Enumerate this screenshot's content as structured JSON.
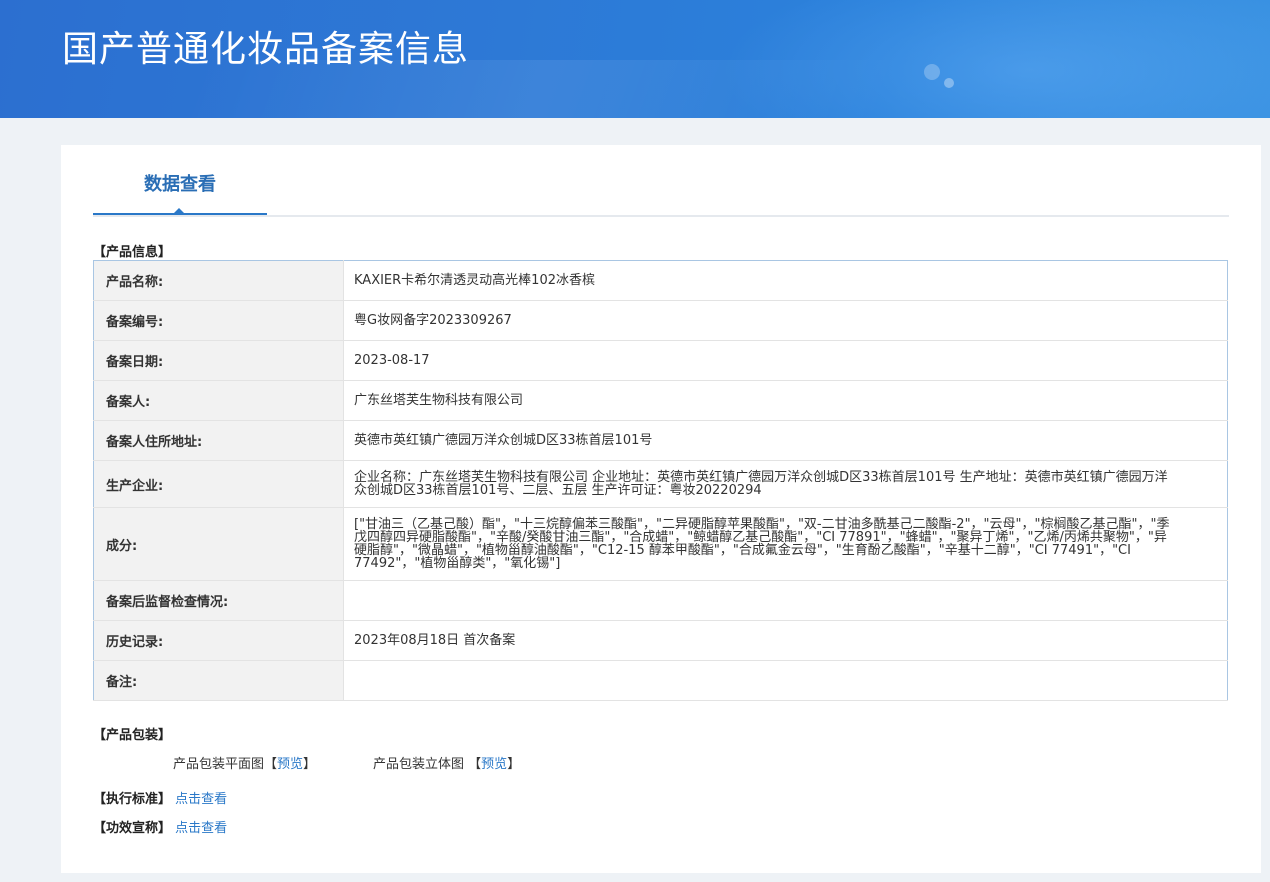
{
  "header": {
    "title": "国产普通化妆品备案信息"
  },
  "tabs": [
    {
      "label": "数据查看"
    }
  ],
  "product_section": {
    "title": "【产品信息】",
    "rows": [
      {
        "label": "产品名称:",
        "value": "KAXIER卡希尔清透灵动高光棒102冰香槟"
      },
      {
        "label": "备案编号:",
        "value": "粤G妆网备字2023309267"
      },
      {
        "label": "备案日期:",
        "value": "2023-08-17"
      },
      {
        "label": "备案人:",
        "value": "广东丝塔芙生物科技有限公司"
      },
      {
        "label": "备案人住所地址:",
        "value": "英德市英红镇广德园万洋众创城D区33栋首层101号"
      },
      {
        "label": "生产企业:",
        "value": "企业名称：广东丝塔芙生物科技有限公司 企业地址：英德市英红镇广德园万洋众创城D区33栋首层101号 生产地址：英德市英红镇广德园万洋众创城D区33栋首层101号、二层、五层 生产许可证：粤妆20220294"
      },
      {
        "label": "成分:",
        "value": "[\"甘油三（乙基己酸）酯\"，\"十三烷醇偏苯三酸酯\"，\"二异硬脂醇苹果酸酯\"，\"双-二甘油多酰基己二酸酯-2\"，\"云母\"，\"棕榈酸乙基己酯\"，\"季戊四醇四异硬脂酸酯\"，\"辛酸/癸酸甘油三酯\"，\"合成蜡\"，\"鲸蜡醇乙基己酸酯\"，\"CI 77891\"，\"蜂蜡\"，\"聚异丁烯\"，\"乙烯/丙烯共聚物\"，\"异硬脂醇\"，\"微晶蜡\"，\"植物甾醇油酸酯\"，\"C12-15 醇苯甲酸酯\"，\"合成氟金云母\"，\"生育酚乙酸酯\"，\"辛基十二醇\"，\"CI 77491\"，\"CI 77492\"，\"植物甾醇类\"，\"氧化锡\"]"
      },
      {
        "label": "备案后监督检查情况:",
        "value": ""
      },
      {
        "label": "历史记录:",
        "value": "2023年08月18日 首次备案"
      },
      {
        "label": "备注:",
        "value": ""
      }
    ]
  },
  "package_section": {
    "title": "【产品包装】",
    "flat_label": "产品包装平面图",
    "solid_label": "产品包装立体图",
    "bracket_open": "【",
    "bracket_close": "】",
    "preview_link": "预览"
  },
  "standard_section": {
    "title": "【执行标准】",
    "link": "点击查看"
  },
  "efficacy_section": {
    "title": "【功效宣称】",
    "link": "点击查看"
  }
}
